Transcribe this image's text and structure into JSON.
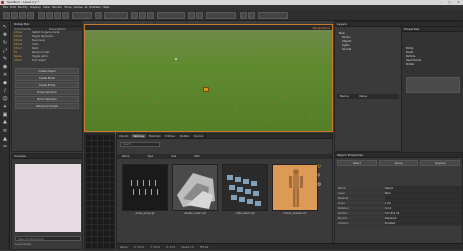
{
  "window": {
    "title": "Sandbox - Level.cry *",
    "minimize": "–",
    "maximize": "□",
    "close": "✕"
  },
  "menu": [
    "File",
    "Edit",
    "Modify",
    "Display",
    "View",
    "Terrain",
    "Tools",
    "Game",
    "AI",
    "Prefabs",
    "Help"
  ],
  "toolbar": {
    "icons": [
      "undo-icon",
      "redo-icon",
      "link-icon",
      "unlink-icon",
      "select-icon",
      "move-icon",
      "rotate-icon",
      "scale-icon",
      "snap-icon",
      "terrain-icon",
      "physics-icon",
      "ai-icon",
      "camera-icon",
      "save-icon"
    ]
  },
  "left_strip_icons": [
    "pointer-icon",
    "move-icon",
    "rotate-icon",
    "scale-icon",
    "brush-icon",
    "camera-icon",
    "light-icon",
    "entity-icon",
    "sound-icon",
    "ai-icon",
    "particle-icon",
    "geometry-icon",
    "vegetation-icon",
    "layer-icon",
    "terrain-icon",
    "road-icon"
  ],
  "commands_panel": {
    "title": "Rollup Bar",
    "columns": [
      "Commands",
      "Description"
    ],
    "rows": [
      {
        "k": "Ctrl+G",
        "d": "Switch to game mode"
      },
      {
        "k": "Ctrl+P",
        "d": "Toggle AI/physics"
      },
      {
        "k": "Ctrl+S",
        "d": "Save level"
      },
      {
        "k": "Ctrl+Z",
        "d": "Undo"
      },
      {
        "k": "Ctrl+Y",
        "d": "Redo"
      },
      {
        "k": "F5",
        "d": "Reload scripts"
      },
      {
        "k": "Space",
        "d": "Toggle gizmo"
      },
      {
        "k": "Ctrl+F",
        "d": "Find object"
      }
    ],
    "buttons": [
      "Create Object",
      "Create Brush",
      "Create Entity",
      "Group Selection",
      "Mirror Selection",
      "Reload All Scripts"
    ]
  },
  "viewport": {
    "label": "Perspective",
    "selected_marker": "Object"
  },
  "right_panel": {
    "title": "Layers",
    "tree": [
      "Main",
      "Terrain",
      "Objects",
      "Lights",
      "Sounds"
    ],
    "props_title": "Properties",
    "props_tree": [
      "Entity",
      "Brush",
      "Particle",
      "GeomCache",
      "Prefab"
    ],
    "table_header": [
      "Name",
      "Value"
    ]
  },
  "lower_left": {
    "title": "Console",
    "input_placeholder": "Type command here",
    "footer": "Level loaded"
  },
  "assets": {
    "tabs": [
      "Objects",
      "Textures",
      "Materials",
      "Entities",
      "Prefabs",
      "Sounds"
    ],
    "active_tab": 1,
    "columns": [
      "Name",
      "Type",
      "Size",
      "Path"
    ],
    "items": [
      {
        "name": "poles_array.cgf",
        "bg": "#1a1a1a"
      },
      {
        "name": "shelter_mesh.cgf",
        "bg": "#4a4a4a"
      },
      {
        "name": "crate_stack.cgf",
        "bg": "#2a2a2a"
      },
      {
        "name": "human_female.chr",
        "bg": "#dc9a55"
      }
    ],
    "search_placeholder": "Search"
  },
  "object_panel": {
    "title": "Object Properties",
    "buttons": [
      "Select",
      "Group",
      "Ungroup"
    ],
    "rows": [
      {
        "n": "Name",
        "v": "Object"
      },
      {
        "n": "Layer",
        "v": "Main"
      },
      {
        "n": "Material",
        "v": ""
      },
      {
        "n": "Scale",
        "v": "1.00"
      },
      {
        "n": "Rotation",
        "v": "0,0,0"
      },
      {
        "n": "Position",
        "v": "512,512,32"
      },
      {
        "n": "Physics",
        "v": "Standard"
      },
      {
        "n": "Collision",
        "v": "Enabled"
      }
    ]
  },
  "status": [
    "Ready",
    "X: 512.0",
    "Y: 512.0",
    "Z: 32.0",
    "Speed 1.0",
    "FPS 60"
  ],
  "colors": {
    "accent": "#c87a30",
    "grass": "#5f8a2e",
    "cube": "#d79020"
  }
}
